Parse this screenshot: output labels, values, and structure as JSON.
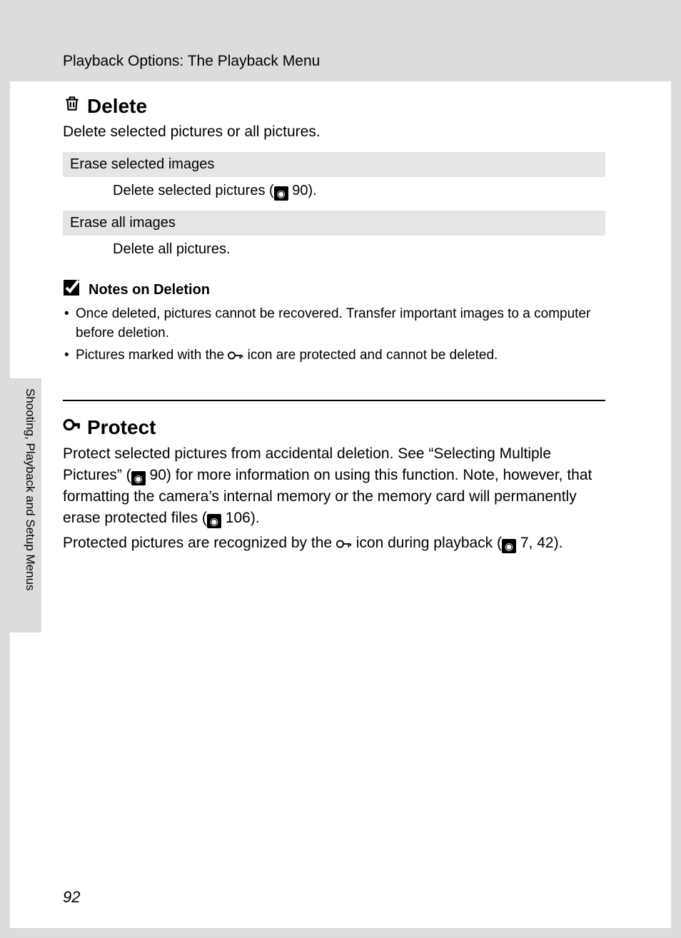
{
  "running_head": "Playback Options: The Playback Menu",
  "delete": {
    "title": "Delete",
    "intro": "Delete selected pictures or all pictures.",
    "options": [
      {
        "label": "Erase selected images",
        "desc_pre": "Delete selected pictures (",
        "ref": "90",
        "desc_post": ")."
      },
      {
        "label": "Erase all images",
        "desc": "Delete all pictures."
      }
    ],
    "notes_title": "Notes on Deletion",
    "notes": [
      "Once deleted, pictures cannot be recovered. Transfer important images to a computer before deletion.",
      "Pictures marked with the |KEY| icon are protected and cannot be deleted."
    ]
  },
  "protect": {
    "title": "Protect",
    "p1_a": "Protect selected pictures from accidental deletion. See “Selecting Multiple Pictures” (",
    "p1_ref1": "90",
    "p1_b": ") for more information on using this function. Note, however, that formatting the camera’s internal memory or the memory card will permanently erase protected files (",
    "p1_ref2": "106",
    "p1_c": ").",
    "p2_a": "Protected pictures are recognized by the ",
    "p2_b": " icon during playback (",
    "p2_ref": "7, 42",
    "p2_c": ")."
  },
  "side_tab": "Shooting, Playback and Setup Menus",
  "page_number": "92"
}
